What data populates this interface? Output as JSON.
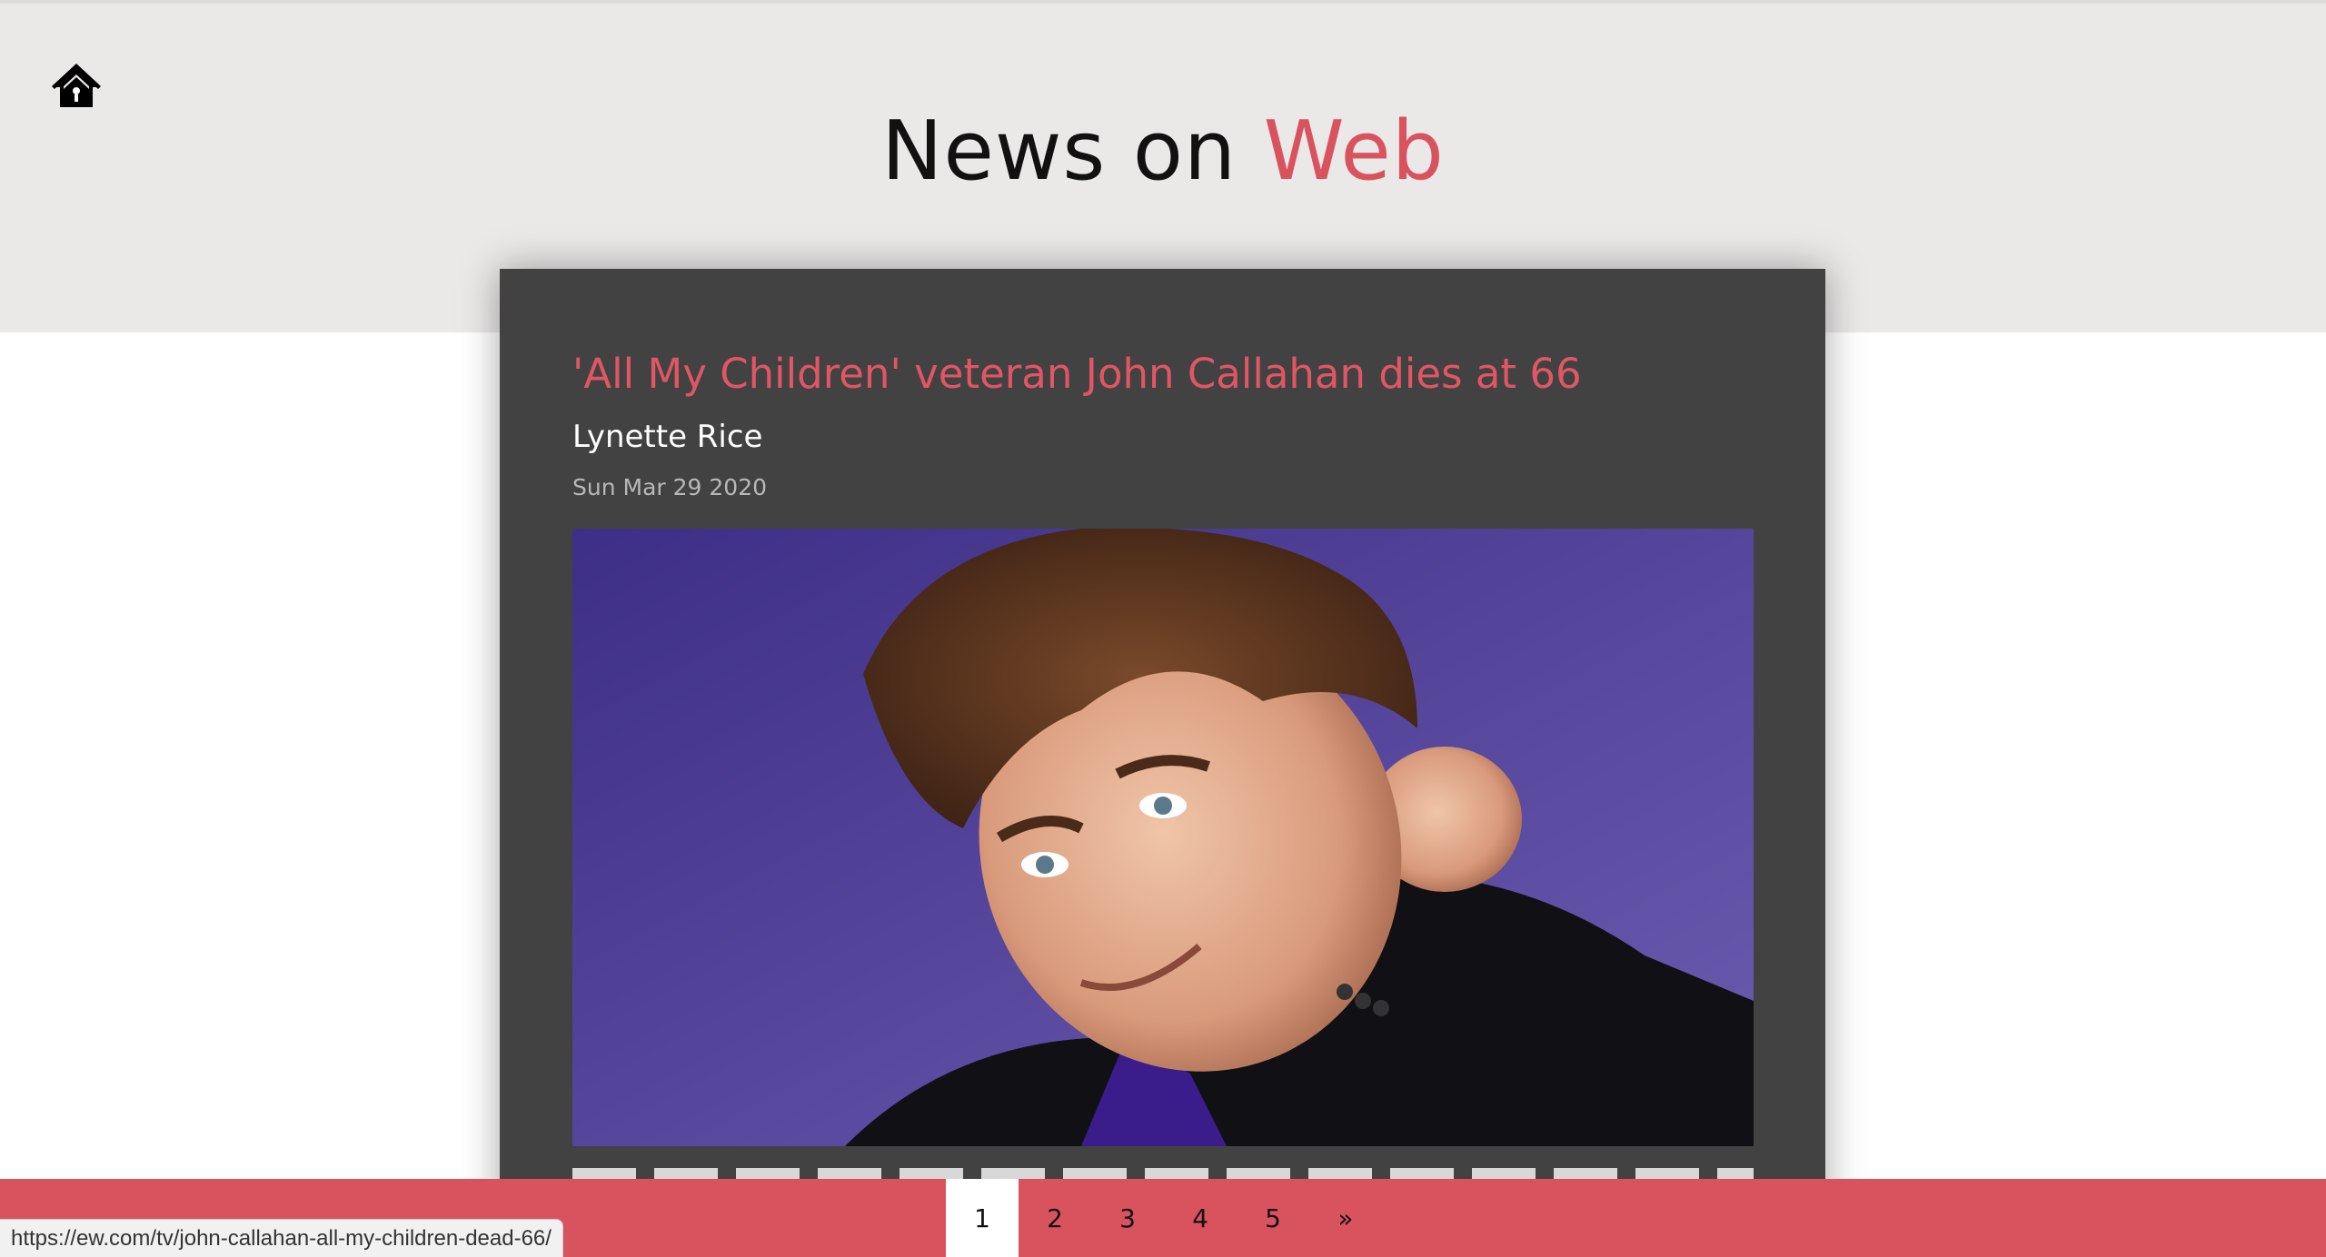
{
  "header": {
    "title_main": "News on",
    "title_accent": "Web",
    "home_icon": "home-icon"
  },
  "article": {
    "title": "'All My Children' veteran John Callahan dies at 66",
    "author": "Lynette Rice",
    "date": "Sun Mar 29 2020",
    "image_alt": "Portrait photo of John Callahan"
  },
  "pagination": {
    "pages": [
      "1",
      "2",
      "3",
      "4",
      "5"
    ],
    "next_label": "»",
    "active": "1"
  },
  "status_bar": {
    "url": "https://ew.com/tv/john-callahan-all-my-children-dead-66/"
  },
  "colors": {
    "accent": "#d9535f",
    "card_bg": "#424242",
    "header_bg": "#ebe9e7"
  }
}
